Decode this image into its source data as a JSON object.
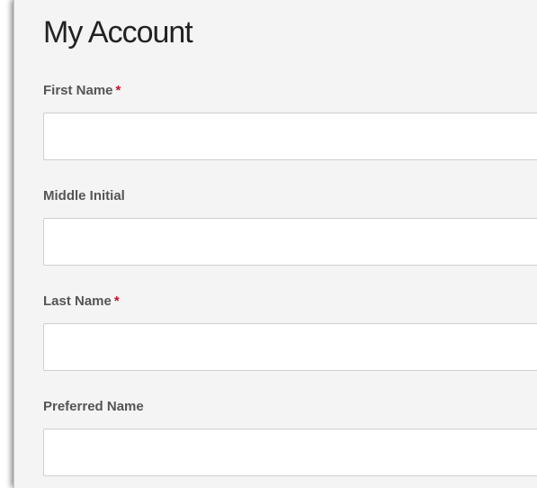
{
  "page": {
    "title": "My Account"
  },
  "form": {
    "required_marker": "*",
    "fields": [
      {
        "label": "First Name",
        "required": true,
        "value": ""
      },
      {
        "label": "Middle Initial",
        "required": false,
        "value": ""
      },
      {
        "label": "Last Name",
        "required": true,
        "value": ""
      },
      {
        "label": "Preferred Name",
        "required": false,
        "value": ""
      }
    ]
  },
  "colors": {
    "required": "#c8102e",
    "label": "#555555",
    "title": "#222222",
    "background": "#f4f4f4"
  }
}
